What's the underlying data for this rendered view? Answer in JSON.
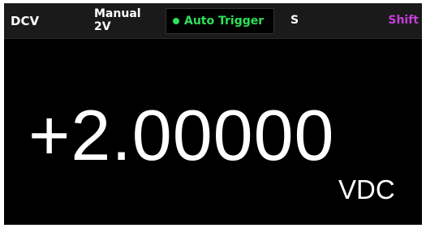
{
  "colors": {
    "screen_bg": "#000000",
    "status_bar_bg": "#1a1a1a",
    "trigger_text": "#2ee05a",
    "trigger_dot": "#2ee05a",
    "shift_text": "#c23fd6",
    "text": "#ffffff"
  },
  "status_bar": {
    "mode": "DCV",
    "range": {
      "line1": "Manual",
      "line2": "2V"
    },
    "trigger": {
      "label": "Auto Trigger",
      "icon": "status-dot-icon"
    },
    "rate": "S",
    "shift": "Shift"
  },
  "display": {
    "reading": "+2.00000",
    "unit": "VDC"
  }
}
